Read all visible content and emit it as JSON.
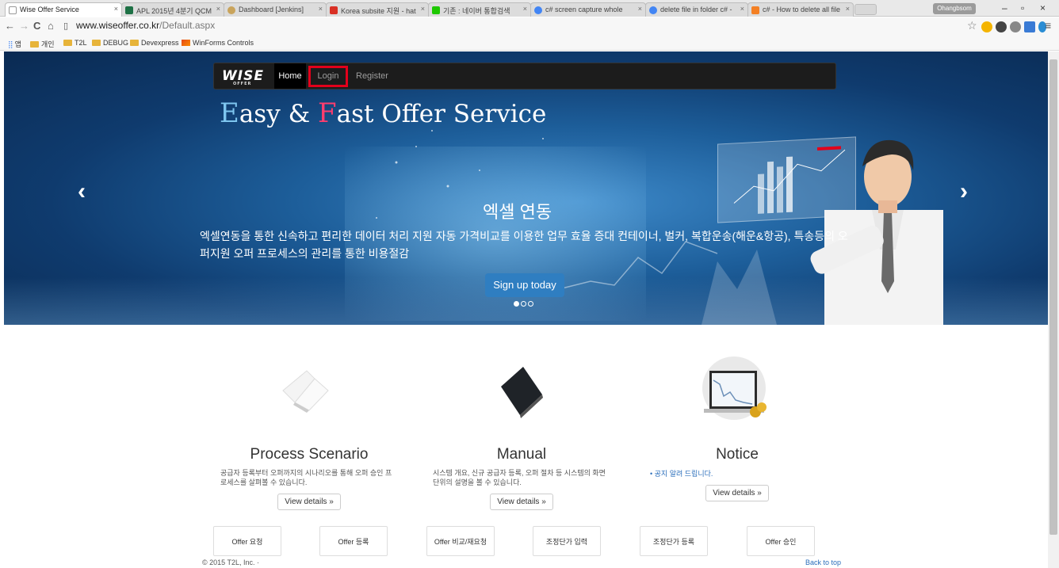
{
  "browser": {
    "tabs": [
      {
        "title": "Wise Offer Service",
        "active": true
      },
      {
        "title": "APL 2015년 4분기 QCM",
        "active": false
      },
      {
        "title": "Dashboard [Jenkins]",
        "active": false
      },
      {
        "title": "Korea subsite 지원 - hat",
        "active": false
      },
      {
        "title": "기존 : 네이버 통합검색",
        "active": false
      },
      {
        "title": "c# screen capture whole",
        "active": false
      },
      {
        "title": "delete file in folder c# -",
        "active": false
      },
      {
        "title": "c# - How to delete all file",
        "active": false
      }
    ],
    "user_badge": "Ohangbsom",
    "url_host": "www.wiseoffer.co.kr",
    "url_path": "/Default.aspx",
    "bookmarks": [
      "앱",
      "개인",
      "T2L",
      "DEBUG",
      "Devexpress",
      "WinForms Controls"
    ],
    "colors": {
      "tab_active": "#ffffff",
      "toolbar": "#f7f7f7"
    }
  },
  "navbar": {
    "logo": "WISE",
    "logo_sub": "OFFER",
    "home": "Home",
    "login": "Login",
    "register": "Register",
    "highlight_color": "#e3001b"
  },
  "hero": {
    "tagline_e": "E",
    "tagline_rest1": "asy & ",
    "tagline_f": "F",
    "tagline_rest2": "ast Offer Service",
    "slide_title": "엑셀 연동",
    "slide_text": "엑셀연동을 통한 신속하고 편리한 데이터 처리 지원 자동 가격비교를 이용한 업무 효율 증대 컨테이너, 벌커, 복합운송(해운&항공), 특송등의 오퍼지원 오퍼 프로세스의 관리를 통한 비용절감",
    "signup": "Sign up today",
    "prev_icon": "‹",
    "next_icon": "›",
    "active_slide": 1,
    "slide_count": 3
  },
  "features": [
    {
      "title": "Process Scenario",
      "text": "공급자 등록부터 오퍼까지의 시나리오를 통해 오퍼 승인 프로세스를 살펴볼 수 있습니다.",
      "button": "View details »"
    },
    {
      "title": "Manual",
      "text": "시스템 개요, 신규 공급자 등록, 오퍼 절차 등 시스템의 화면단위의 설명을 볼 수 있습니다.",
      "button": "View details »"
    },
    {
      "title": "Notice",
      "bullet": "공지 알려 드립니다.",
      "button": "View details »"
    }
  ],
  "offer_buttons": [
    "Offer 요청",
    "Offer 등록",
    "Offer 비교/재요청",
    "조정단가 입력",
    "조정단가 등록",
    "Offer 승인"
  ],
  "footer": {
    "copyright": "© 2015 T2L, Inc. ·",
    "back_to_top": "Back to top"
  }
}
